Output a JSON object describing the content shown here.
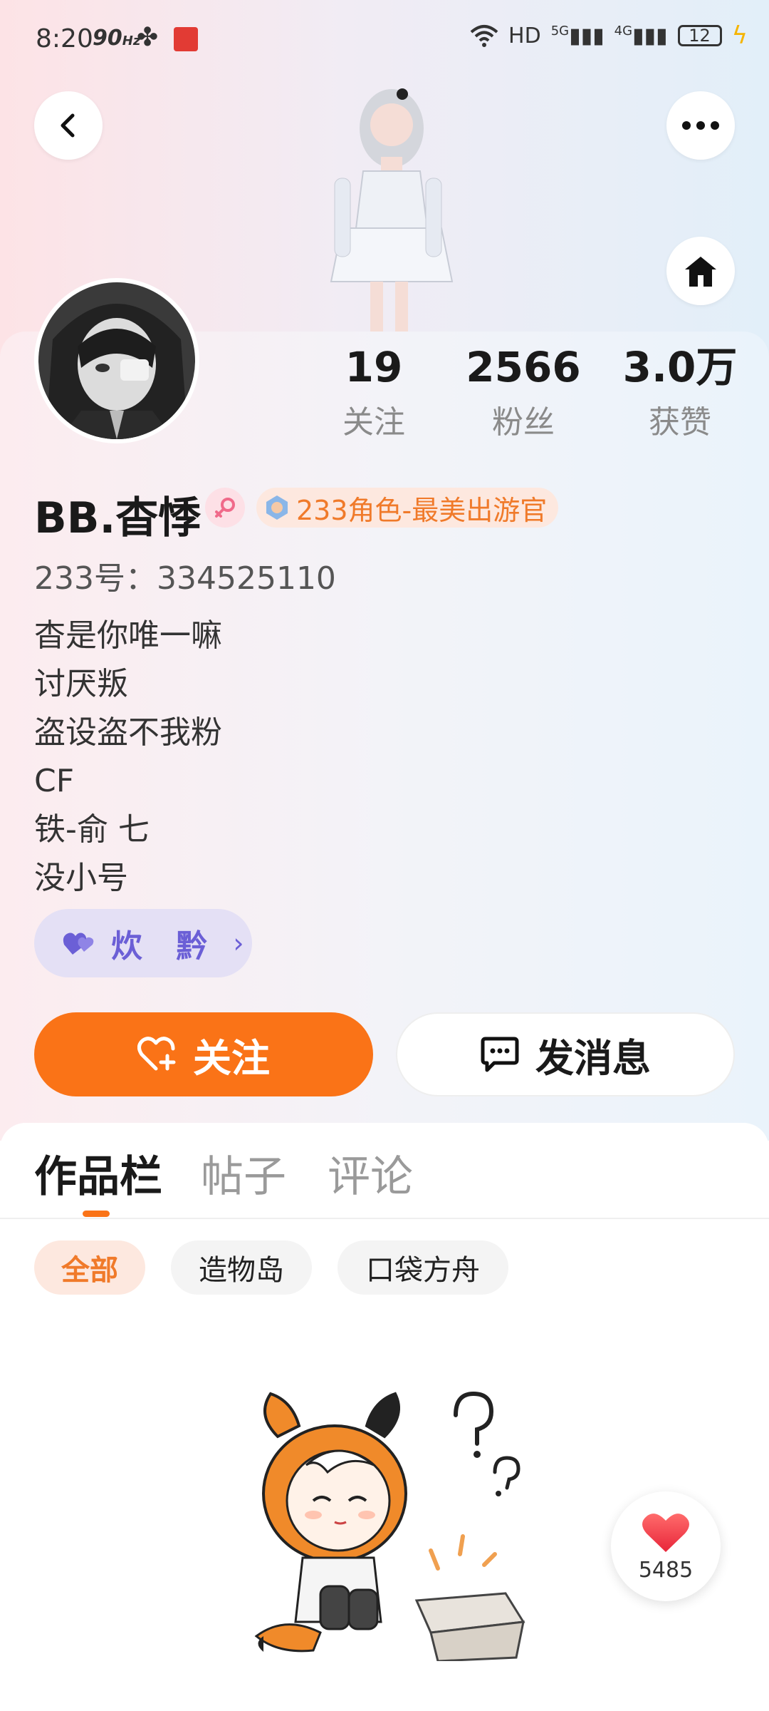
{
  "status_bar": {
    "time": "8:20",
    "refresh": "90",
    "refresh_unit": "Hz",
    "network": "HD",
    "sig1": "5G",
    "sig2": "4G",
    "battery": "12"
  },
  "profile": {
    "stats": [
      {
        "value": "19",
        "label": "关注"
      },
      {
        "value": "2566",
        "label": "粉丝"
      },
      {
        "value": "3.0万",
        "label": "获赞"
      }
    ],
    "username": "BB.杳悸",
    "title_badge": "233角色-最美出游官",
    "uid": "233号：334525110",
    "bio": [
      "杳是你唯一嘛",
      "讨厌叛",
      "盗设盗不我粉",
      "CF",
      "铁-俞 七",
      "没小号"
    ],
    "group_name": "炊 黔",
    "follow_label": "关注",
    "message_label": "发消息"
  },
  "tabs": [
    {
      "label": "作品栏",
      "active": true
    },
    {
      "label": "帖子",
      "active": false
    },
    {
      "label": "评论",
      "active": false
    }
  ],
  "filters": [
    {
      "label": "全部",
      "active": true
    },
    {
      "label": "造物岛",
      "active": false
    },
    {
      "label": "口袋方舟",
      "active": false
    }
  ],
  "like_count": "5485",
  "colors": {
    "accent": "#fa7317",
    "badge_text": "#f07a2a",
    "group_purple": "#6b5fd6"
  }
}
